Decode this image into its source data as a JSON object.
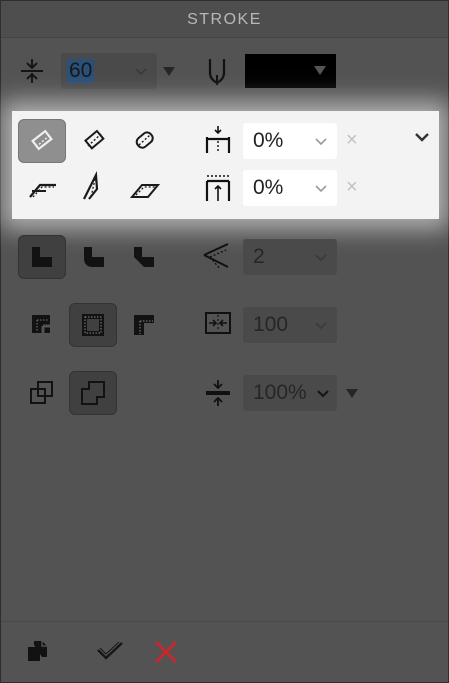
{
  "panel": {
    "title": "STROKE"
  },
  "weight": {
    "value": "60"
  },
  "color_swatch": {
    "color": "#000000"
  },
  "align": {
    "start_offset": "0%",
    "end_offset": "0%",
    "remove_symbol": "×"
  },
  "miter_limit": {
    "value": "2"
  },
  "scale_field": {
    "value": "100"
  },
  "width_field": {
    "value": "100%"
  },
  "footer": {
    "icons": [
      "copy-icon",
      "checkmark-icon",
      "cancel-icon"
    ],
    "cancel_color": "#c8282a"
  },
  "colors": {
    "panel_bg": "#535353",
    "highlight_bg": "#f3f3f3",
    "selected_button": "#404040",
    "selected_button_light": "#8f8f8f"
  }
}
